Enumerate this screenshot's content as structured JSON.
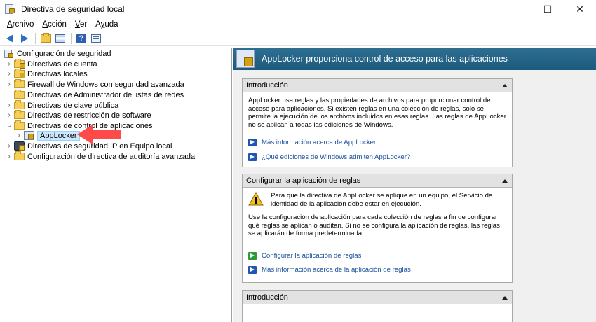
{
  "window": {
    "title": "Directiva de seguridad local",
    "minimize": "—",
    "maximize": "☐",
    "close": "✕"
  },
  "menu": {
    "items": [
      {
        "label": "Archivo",
        "mnemonic": "A",
        "rest": "rchivo"
      },
      {
        "label": "Acción",
        "mnemonic": "A",
        "rest": "cción"
      },
      {
        "label": "Ver",
        "mnemonic": "V",
        "rest": "er"
      },
      {
        "label": "Ayuda",
        "mnemonic": "y",
        "rest": "uda",
        "prefix": "A"
      }
    ]
  },
  "toolbar": {
    "help_glyph": "?"
  },
  "tree": {
    "root": "Configuración de seguridad",
    "items": [
      {
        "label": "Directivas de cuenta"
      },
      {
        "label": "Directivas locales"
      },
      {
        "label": "Firewall de Windows con seguridad avanzada"
      },
      {
        "label": "Directivas de Administrador de listas de redes"
      },
      {
        "label": "Directivas de clave pública"
      },
      {
        "label": "Directivas de restricción de software"
      },
      {
        "label": "Directivas de control de aplicaciones"
      },
      {
        "label": "AppLocker"
      },
      {
        "label": "Directivas de seguridad IP en Equipo local"
      },
      {
        "label": "Configuración de directiva de auditoría avanzada"
      }
    ]
  },
  "banner": {
    "text": "AppLocker proporciona control de acceso para las aplicaciones"
  },
  "panels": {
    "intro": {
      "title": "Introducción",
      "body": "AppLocker usa reglas y las propiedades de archivos para proporcionar control de acceso para aplicaciones. Si existen reglas en una colección de reglas, solo se permite la ejecución de los archivos incluidos en esas reglas. Las reglas de AppLocker no se aplican a todas las ediciones de Windows.",
      "link1": "Más información acerca de AppLocker",
      "link2": "¿Qué ediciones de Windows admiten AppLocker?"
    },
    "rules": {
      "title": "Configurar la aplicación de reglas",
      "warning": "Para que la directiva de AppLocker se aplique en un equipo, el Servicio de identidad de la aplicación debe estar en ejecución.",
      "body": "Use la configuración de aplicación para cada colección de reglas a fin de configurar qué reglas se aplican o auditan. Si no se configura la aplicación de reglas, las reglas se aplicarán de forma predeterminada.",
      "link1": "Configurar la aplicación de reglas",
      "link2": "Más información acerca de la aplicación de reglas"
    },
    "intro2": {
      "title": "Introducción"
    }
  },
  "colors": {
    "banner": "#1d5a7d",
    "link": "#1a4f9c",
    "selection": "#cce8ff",
    "annotation_arrow": "#ff4a4a"
  }
}
